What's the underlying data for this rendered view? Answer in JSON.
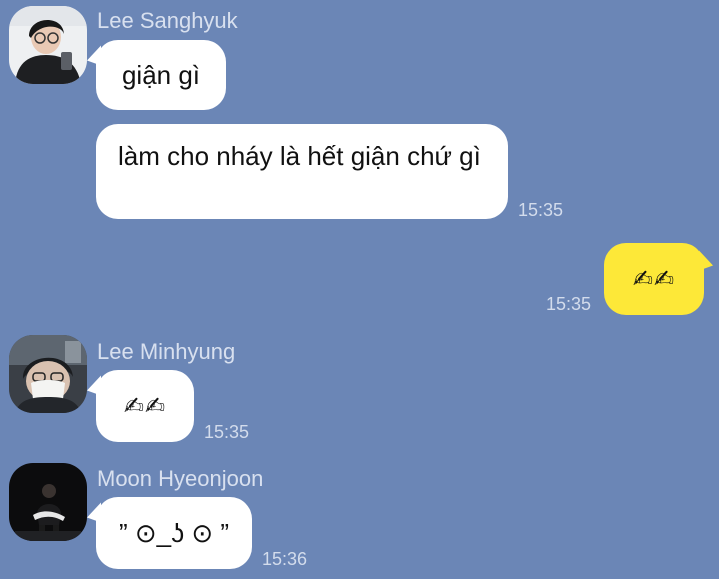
{
  "colors": {
    "chat_background": "#6b86b6",
    "incoming_bubble": "#ffffff",
    "outgoing_bubble": "#fde838",
    "sender_name": "#d8e0ef",
    "timestamp": "#d3dcec"
  },
  "messages": [
    {
      "sender": "Lee Sanghyuk",
      "avatar_icon": "profile-photo-lee-sanghyuk",
      "text": "giận gì"
    },
    {
      "sender": "Lee Sanghyuk",
      "text": "làm cho nháy là hết giận chứ gì",
      "time": "15:35"
    },
    {
      "sender": "me",
      "text": "✍✍",
      "time": "15:35"
    },
    {
      "sender": "Lee Minhyung",
      "avatar_icon": "profile-photo-lee-minhyung",
      "text": "✍✍",
      "time": "15:35"
    },
    {
      "sender": "Moon Hyeonjoon",
      "avatar_icon": "profile-photo-moon-hyeonjoon",
      "text": "” ⊙_ʖ ⊙ ”",
      "time": "15:36"
    }
  ]
}
